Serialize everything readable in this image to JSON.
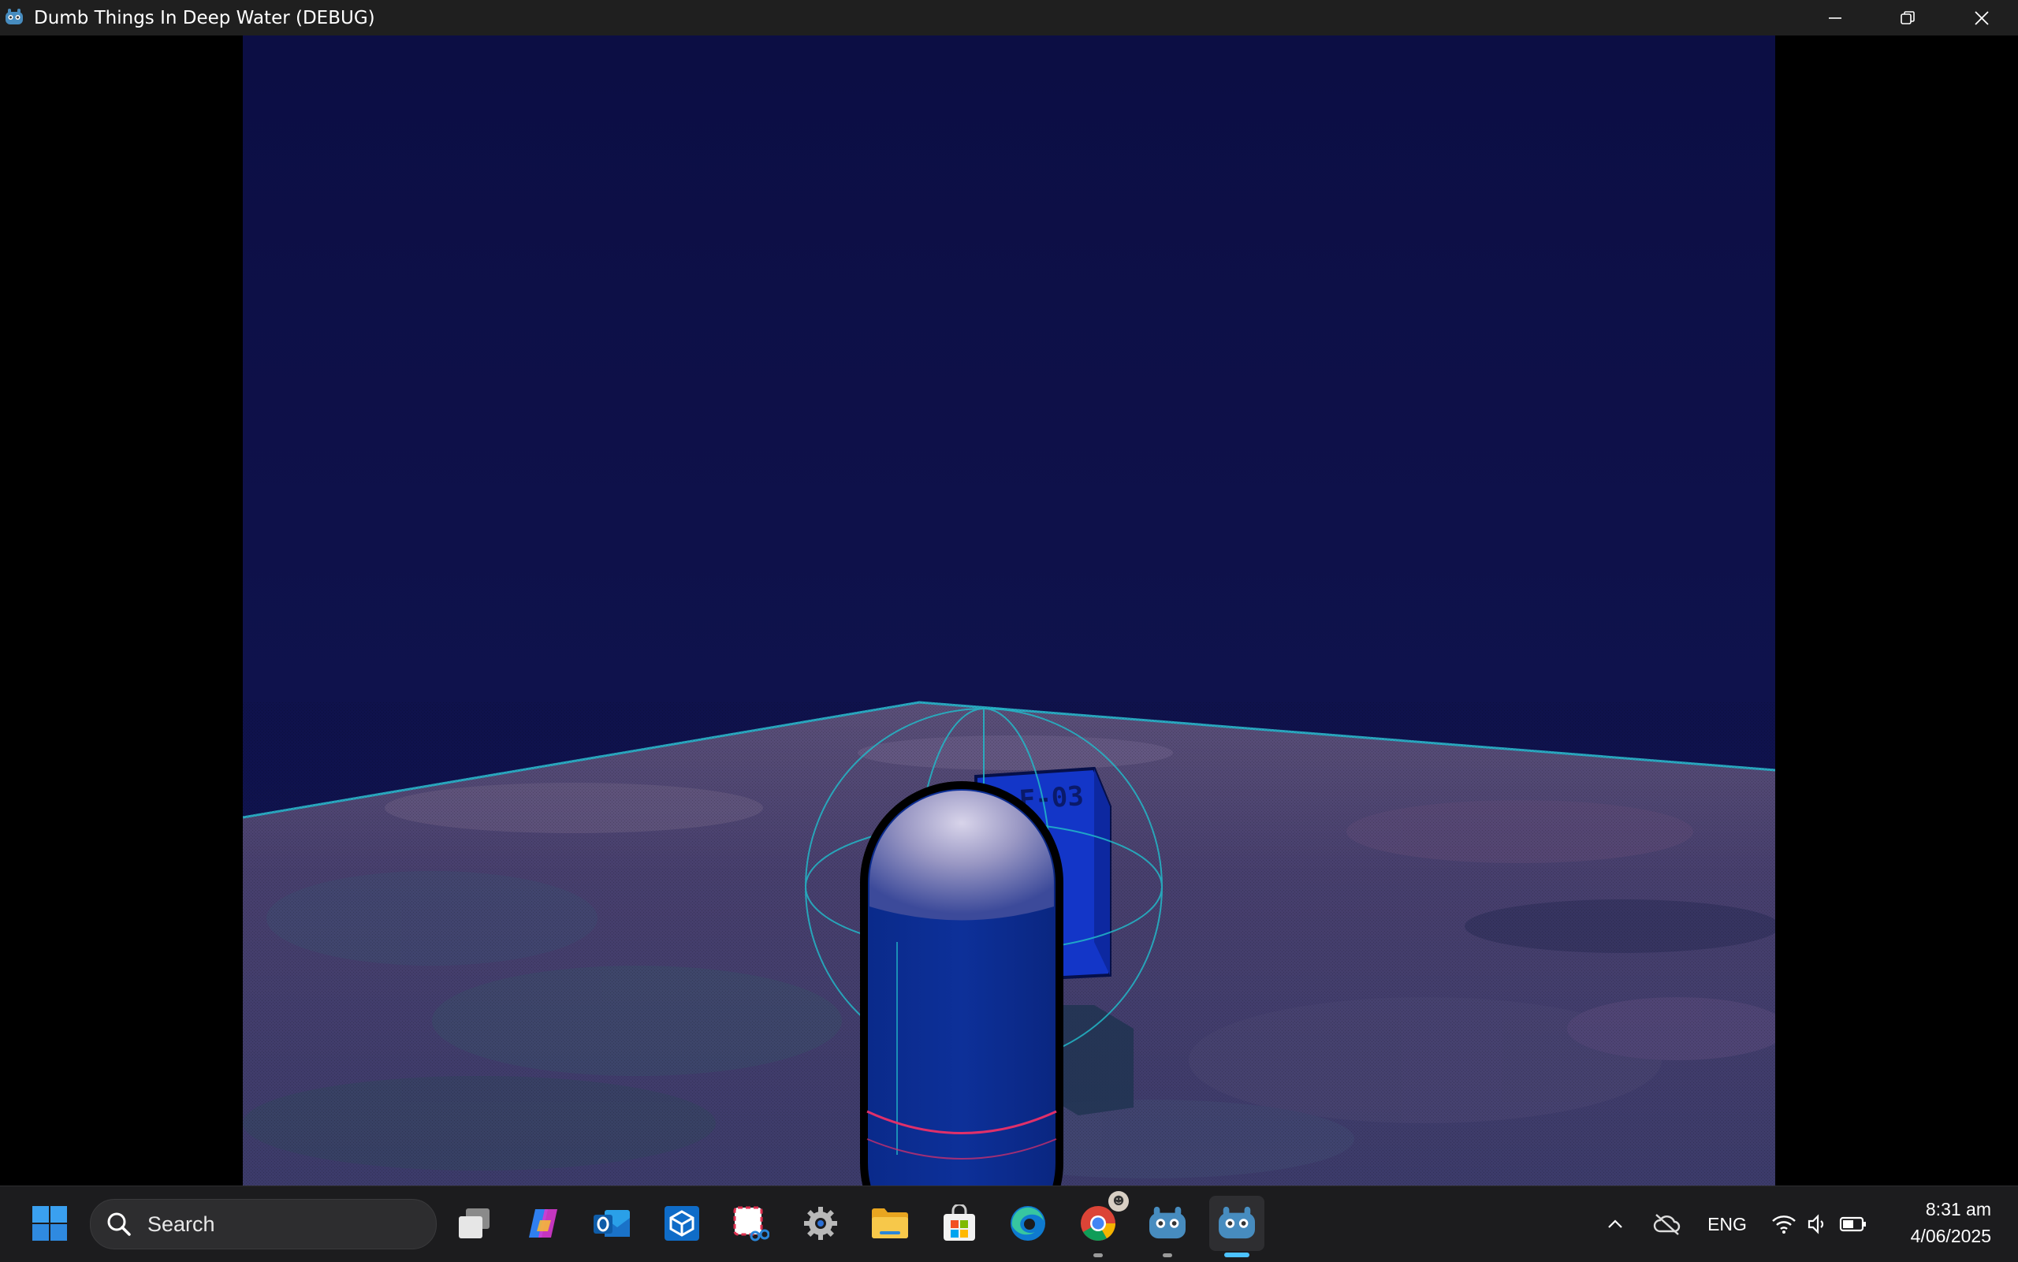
{
  "window": {
    "title": "Dumb Things In Deep Water (DEBUG)",
    "app_icon": "godot-icon",
    "controls": [
      "minimize-icon",
      "restore-icon",
      "close-icon"
    ]
  },
  "game": {
    "box_label": "F-03"
  },
  "taskbar": {
    "search_placeholder": "Search",
    "apps": [
      {
        "name": "start",
        "icon": "windows-start-icon"
      },
      {
        "name": "task-view",
        "icon": "task-view-icon"
      },
      {
        "name": "copilot",
        "icon": "copilot-icon"
      },
      {
        "name": "outlook",
        "icon": "outlook-icon"
      },
      {
        "name": "package",
        "icon": "package-app-icon"
      },
      {
        "name": "snipping-tool",
        "icon": "snipping-tool-icon"
      },
      {
        "name": "settings",
        "icon": "gear-icon"
      },
      {
        "name": "file-explorer",
        "icon": "folder-icon"
      },
      {
        "name": "microsoft-store",
        "icon": "store-icon"
      },
      {
        "name": "edge",
        "icon": "edge-icon"
      },
      {
        "name": "chrome",
        "icon": "chrome-icon"
      },
      {
        "name": "godot-editor",
        "icon": "godot-icon"
      },
      {
        "name": "godot-game",
        "icon": "godot-icon"
      }
    ],
    "tray": {
      "language": "ENG",
      "time": "8:31 am",
      "date": "4/06/2025"
    }
  },
  "colors": {
    "sky": "#0e1046",
    "ground": "#403f6c",
    "capsule": "#0b2a8c",
    "box": "#1133cc",
    "debug_cyan": "#22b8c8",
    "debug_pink": "#e0306a",
    "accent": "#4cc2ff"
  }
}
